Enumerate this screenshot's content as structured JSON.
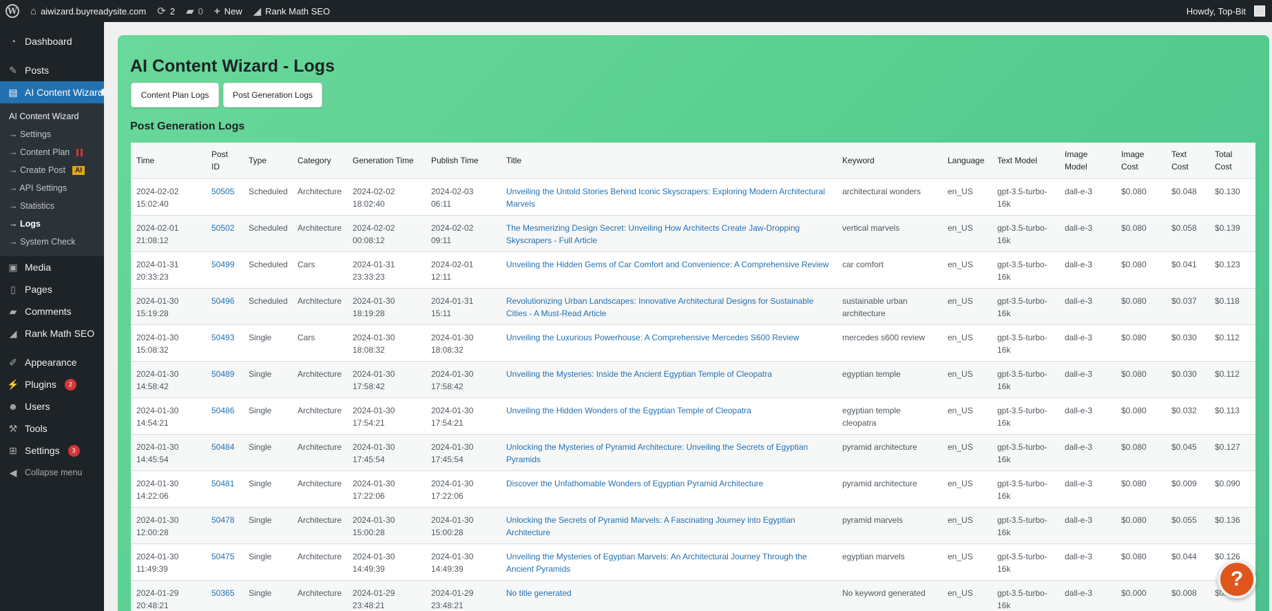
{
  "adminbar": {
    "site_name": "aiwizard.buyreadysite.com",
    "updates_count": "2",
    "comments_count": "0",
    "new_label": "New",
    "rankmath_label": "Rank Math SEO",
    "howdy": "Howdy, Top-Bit"
  },
  "sidebar": {
    "dashboard": "Dashboard",
    "posts": "Posts",
    "ai_wizard": "AI Content Wizard",
    "submenu": {
      "head": "AI Content Wizard",
      "settings": "→ Settings",
      "content_plan": "→ Content Plan",
      "create_post": "→ Create Post",
      "create_post_badge": "AI",
      "api_settings": "→ API Settings",
      "statistics": "→ Statistics",
      "logs": "→ Logs",
      "system_check": "→ System Check"
    },
    "media": "Media",
    "pages": "Pages",
    "comments": "Comments",
    "rankmath": "Rank Math SEO",
    "appearance": "Appearance",
    "plugins": "Plugins",
    "plugins_badge": "2",
    "users": "Users",
    "tools": "Tools",
    "settings": "Settings",
    "settings_badge": "3",
    "collapse": "Collapse menu"
  },
  "main": {
    "title": "AI Content Wizard - Logs",
    "btn_content_plan": "Content Plan Logs",
    "btn_post_generation": "Post Generation Logs",
    "section_title": "Post Generation Logs"
  },
  "table": {
    "headers": [
      "Time",
      "Post ID",
      "Type",
      "Category",
      "Generation Time",
      "Publish Time",
      "Title",
      "Keyword",
      "Language",
      "Text Model",
      "Image Model",
      "Image Cost",
      "Text Cost",
      "Total Cost"
    ],
    "rows": [
      [
        "2024-02-02 15:02:40",
        "50505",
        "Scheduled",
        "Architecture",
        "2024-02-02 18:02:40",
        "2024-02-03 06:11",
        "Unveiling the Untold Stories Behind Iconic Skyscrapers: Exploring Modern Architectural Marvels",
        "architectural wonders",
        "en_US",
        "gpt-3.5-turbo-16k",
        "dall-e-3",
        "$0.080",
        "$0.048",
        "$0.130"
      ],
      [
        "2024-02-01 21:08:12",
        "50502",
        "Scheduled",
        "Architecture",
        "2024-02-02 00:08:12",
        "2024-02-02 09:11",
        "The Mesmerizing Design Secret: Unveiling How Architects Create Jaw-Dropping Skyscrapers - Full Article",
        "vertical marvels",
        "en_US",
        "gpt-3.5-turbo-16k",
        "dall-e-3",
        "$0.080",
        "$0.058",
        "$0.139"
      ],
      [
        "2024-01-31 20:33:23",
        "50499",
        "Scheduled",
        "Cars",
        "2024-01-31 23:33:23",
        "2024-02-01 12:11",
        "Unveiling the Hidden Gems of Car Comfort and Convenience: A Comprehensive Review",
        "car comfort",
        "en_US",
        "gpt-3.5-turbo-16k",
        "dall-e-3",
        "$0.080",
        "$0.041",
        "$0.123"
      ],
      [
        "2024-01-30 15:19:28",
        "50496",
        "Scheduled",
        "Architecture",
        "2024-01-30 18:19:28",
        "2024-01-31 15:11",
        "Revolutionizing Urban Landscapes: Innovative Architectural Designs for Sustainable Cities - A Must-Read Article",
        "sustainable urban architecture",
        "en_US",
        "gpt-3.5-turbo-16k",
        "dall-e-3",
        "$0.080",
        "$0.037",
        "$0.118"
      ],
      [
        "2024-01-30 15:08:32",
        "50493",
        "Single",
        "Cars",
        "2024-01-30 18:08:32",
        "2024-01-30 18:08:32",
        "Unveiling the Luxurious Powerhouse: A Comprehensive Mercedes S600 Review",
        "mercedes s600 review",
        "en_US",
        "gpt-3.5-turbo-16k",
        "dall-e-3",
        "$0.080",
        "$0.030",
        "$0.112"
      ],
      [
        "2024-01-30 14:58:42",
        "50489",
        "Single",
        "Architecture",
        "2024-01-30 17:58:42",
        "2024-01-30 17:58:42",
        "Unveiling the Mysteries: Inside the Ancient Egyptian Temple of Cleopatra",
        "egyptian temple",
        "en_US",
        "gpt-3.5-turbo-16k",
        "dall-e-3",
        "$0.080",
        "$0.030",
        "$0.112"
      ],
      [
        "2024-01-30 14:54:21",
        "50486",
        "Single",
        "Architecture",
        "2024-01-30 17:54:21",
        "2024-01-30 17:54:21",
        "Unveiling the Hidden Wonders of the Egyptian Temple of Cleopatra",
        "egyptian temple cleopatra",
        "en_US",
        "gpt-3.5-turbo-16k",
        "dall-e-3",
        "$0.080",
        "$0.032",
        "$0.113"
      ],
      [
        "2024-01-30 14:45:54",
        "50484",
        "Single",
        "Architecture",
        "2024-01-30 17:45:54",
        "2024-01-30 17:45:54",
        "Unlocking the Mysteries of Pyramid Architecture: Unveiling the Secrets of Egyptian Pyramids",
        "pyramid architecture",
        "en_US",
        "gpt-3.5-turbo-16k",
        "dall-e-3",
        "$0.080",
        "$0.045",
        "$0.127"
      ],
      [
        "2024-01-30 14:22:06",
        "50481",
        "Single",
        "Architecture",
        "2024-01-30 17:22:06",
        "2024-01-30 17:22:06",
        "Discover the Unfathomable Wonders of Egyptian Pyramid Architecture",
        "pyramid architecture",
        "en_US",
        "gpt-3.5-turbo-16k",
        "dall-e-3",
        "$0.080",
        "$0.009",
        "$0.090"
      ],
      [
        "2024-01-30 12:00:28",
        "50478",
        "Single",
        "Architecture",
        "2024-01-30 15:00:28",
        "2024-01-30 15:00:28",
        "Unlocking the Secrets of Pyramid Marvels: A Fascinating Journey into Egyptian Architecture",
        "pyramid marvels",
        "en_US",
        "gpt-3.5-turbo-16k",
        "dall-e-3",
        "$0.080",
        "$0.055",
        "$0.136"
      ],
      [
        "2024-01-30 11:49:39",
        "50475",
        "Single",
        "Architecture",
        "2024-01-30 14:49:39",
        "2024-01-30 14:49:39",
        "Unveiling the Mysteries of Egyptian Marvels: An Architectural Journey Through the Ancient Pyramids",
        "egyptian marvels",
        "en_US",
        "gpt-3.5-turbo-16k",
        "dall-e-3",
        "$0.080",
        "$0.044",
        "$0.126"
      ],
      [
        "2024-01-29 20:48:21",
        "50365",
        "Single",
        "Architecture",
        "2024-01-29 23:48:21",
        "2024-01-29 23:48:21",
        "No title generated",
        "No keyword generated",
        "en_US",
        "gpt-3.5-turbo-16k",
        "dall-e-3",
        "$0.000",
        "$0.008",
        "$0.008"
      ]
    ]
  },
  "help_icon": "?"
}
